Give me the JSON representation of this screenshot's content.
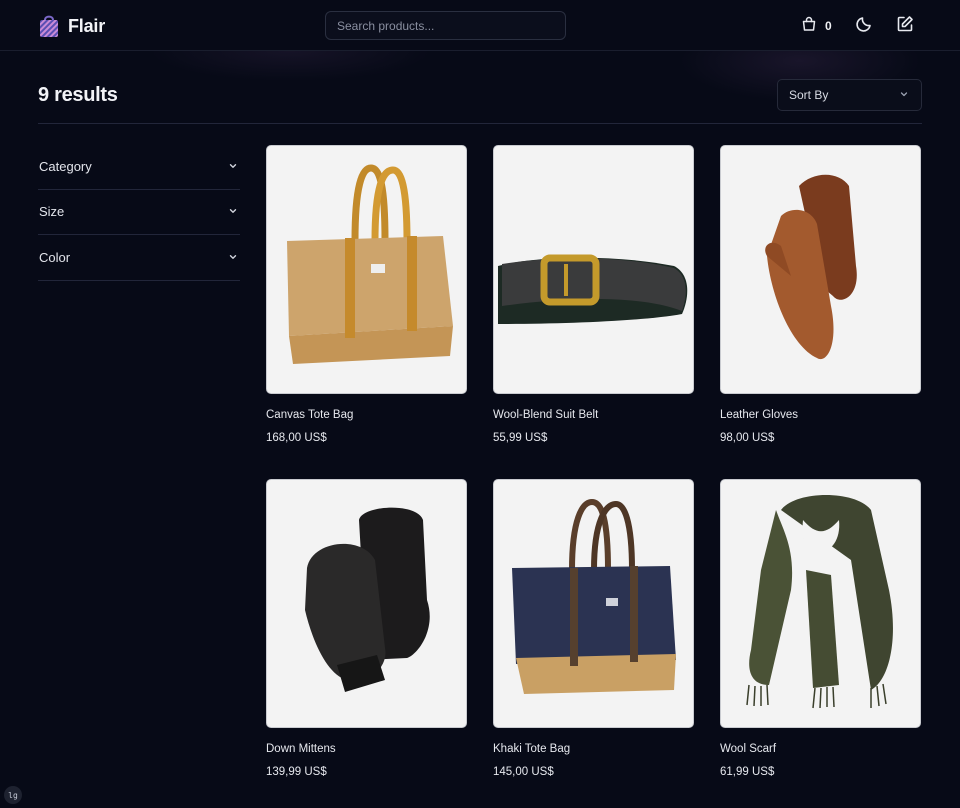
{
  "header": {
    "brand": "Flair",
    "search_placeholder": "Search products...",
    "cart_count": "0",
    "icons": [
      "shopping-bag-logo-icon",
      "cart-icon",
      "moon-icon",
      "edit-icon"
    ]
  },
  "toolbar": {
    "results_label": "9 results",
    "sort_label": "Sort By"
  },
  "filters": {
    "items": [
      {
        "label": "Category"
      },
      {
        "label": "Size"
      },
      {
        "label": "Color"
      }
    ]
  },
  "products": [
    {
      "name": "Canvas Tote Bag",
      "price": "168,00 US$"
    },
    {
      "name": "Wool-Blend Suit Belt",
      "price": "55,99 US$"
    },
    {
      "name": "Leather Gloves",
      "price": "98,00 US$"
    },
    {
      "name": "Down Mittens",
      "price": "139,99 US$"
    },
    {
      "name": "Khaki Tote Bag",
      "price": "145,00 US$"
    },
    {
      "name": "Wool Scarf",
      "price": "61,99 US$"
    }
  ],
  "badge": {
    "label": "lg"
  },
  "colors": {
    "background": "#070a17",
    "border": "#22263a",
    "card_bg": "#f3f3f3"
  }
}
